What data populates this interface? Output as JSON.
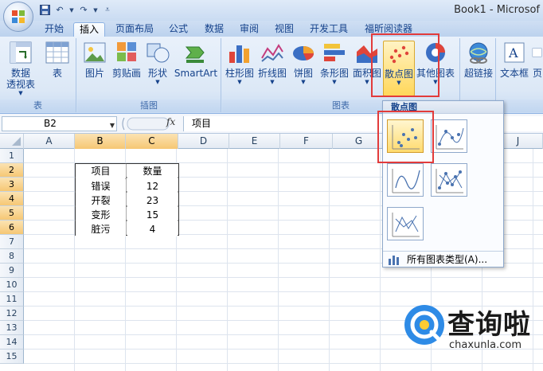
{
  "window": {
    "title": "Book1 - Microsof"
  },
  "tabs": [
    {
      "label": "开始"
    },
    {
      "label": "插入"
    },
    {
      "label": "页面布局"
    },
    {
      "label": "公式"
    },
    {
      "label": "数据"
    },
    {
      "label": "审阅"
    },
    {
      "label": "视图"
    },
    {
      "label": "开发工具"
    },
    {
      "label": "福昕阅读器"
    }
  ],
  "ribbon": {
    "groups": {
      "table": "表",
      "illustrations": "插图",
      "charts": "图表"
    },
    "buttons": {
      "pivot_line1": "数据",
      "pivot_line2": "透视表",
      "table": "表",
      "picture": "图片",
      "clipart": "剪贴画",
      "shapes": "形状",
      "smartart": "SmartArt",
      "column": "柱形图",
      "line": "折线图",
      "pie": "饼图",
      "bar": "条形图",
      "area": "面积图",
      "scatter": "散点图",
      "other": "其他图表",
      "hyperlink": "超链接",
      "textbox": "文本框",
      "header_partial": "页"
    }
  },
  "formula_bar": {
    "name_box": "B2",
    "fx": "fx",
    "content": "项目"
  },
  "columns": [
    "A",
    "B",
    "C",
    "D",
    "E",
    "F",
    "G",
    "J"
  ],
  "rows": [
    "1",
    "2",
    "3",
    "4",
    "5",
    "6",
    "7",
    "8",
    "9",
    "10",
    "11",
    "12",
    "13",
    "14",
    "15"
  ],
  "table": {
    "headers": [
      "项目",
      "数量"
    ],
    "rows": [
      [
        "错误",
        "12"
      ],
      [
        "开裂",
        "23"
      ],
      [
        "变形",
        "15"
      ],
      [
        "脏污",
        "4"
      ]
    ]
  },
  "gallery": {
    "title": "散点图",
    "footer": "所有图表类型(A)..."
  },
  "watermark": {
    "text": "查询啦",
    "sub": "chaxunla.com"
  }
}
